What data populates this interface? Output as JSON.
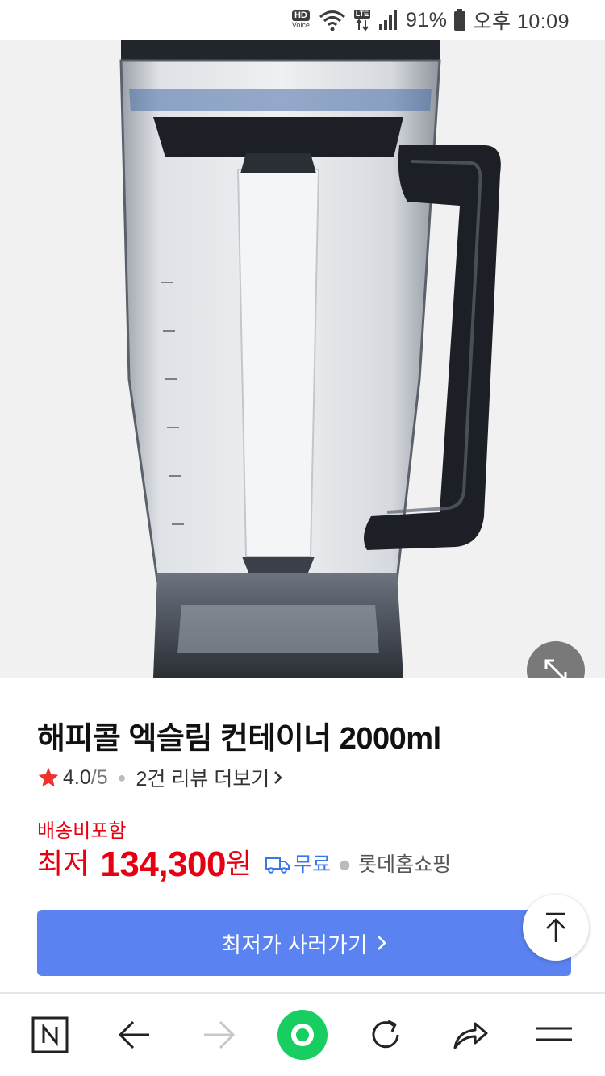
{
  "status_bar": {
    "hd": "HD",
    "voice": "Voice",
    "lte": "LTE",
    "battery": "91%",
    "time": "오후 10:09"
  },
  "product": {
    "title": "해피콜 엑슬림 컨테이너 2000ml",
    "rating": "4.0",
    "rating_max": "/5",
    "reviews_link": "2건 리뷰 더보기",
    "shipping": "배송비포함",
    "price_prefix": "최저",
    "price": "134,300",
    "price_unit": "원",
    "free_shipping": "무료",
    "seller": "롯데홈쇼핑"
  },
  "cta": {
    "label": "최저가 사러가기"
  },
  "icons": {
    "zoom": "expand-icon",
    "scroll_top": "arrow-up-icon",
    "nav": [
      "naver-n-icon",
      "back-arrow-icon",
      "forward-arrow-icon",
      "green-home-icon",
      "refresh-icon",
      "share-icon",
      "menu-icon"
    ]
  },
  "colors": {
    "price_red": "#e60012",
    "link_blue": "#3a77e8",
    "cta_blue": "#5a82f0",
    "star_red": "#f0322d",
    "nav_green": "#19ce60"
  }
}
